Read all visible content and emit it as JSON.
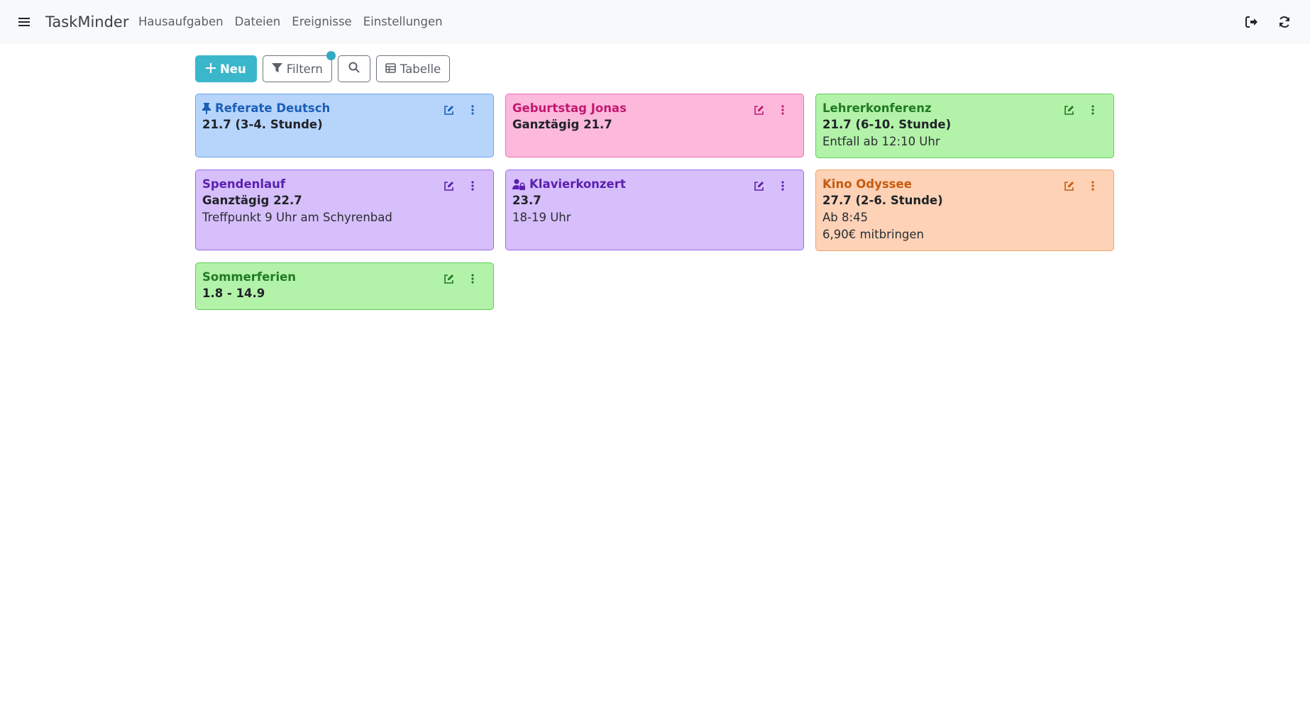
{
  "app": {
    "brand": "TaskMinder"
  },
  "nav": {
    "links": [
      "Hausaufgaben",
      "Dateien",
      "Ereignisse",
      "Einstellungen"
    ]
  },
  "toolbar": {
    "new_label": "Neu",
    "filter_label": "Filtern",
    "table_label": "Tabelle"
  },
  "colors": {
    "primary": "#3bb7cb",
    "blue": "#b7d4fb",
    "pink": "#fcb9dc",
    "green": "#b3f2a9",
    "purple": "#d6bffa",
    "orange": "#fdd2b6"
  },
  "cards": [
    {
      "title": "Referate Deutsch",
      "color": "blue",
      "icon": "pin-icon",
      "lines": [
        "21.7 (3-4. Stunde)"
      ]
    },
    {
      "title": "Geburtstag Jonas",
      "color": "pink",
      "icon": "",
      "lines": [
        "Ganztägig 21.7"
      ]
    },
    {
      "title": "Lehrerkonferenz",
      "color": "green",
      "icon": "",
      "lines": [
        "21.7 (6-10. Stunde)",
        "Entfall ab 12:10 Uhr"
      ]
    },
    {
      "title": "Spendenlauf",
      "color": "purple",
      "icon": "",
      "lines": [
        "Ganztägig 22.7",
        "Treffpunkt 9 Uhr am Schyrenbad"
      ]
    },
    {
      "title": "Klavierkonzert",
      "color": "purple",
      "icon": "user-lock-icon",
      "lines": [
        "23.7",
        "18-19 Uhr"
      ]
    },
    {
      "title": "Kino Odyssee",
      "color": "orange",
      "icon": "",
      "lines": [
        "27.7 (2-6. Stunde)",
        "Ab 8:45",
        "6,90€ mitbringen"
      ]
    },
    {
      "title": "Sommerferien",
      "color": "green",
      "icon": "",
      "lines": [
        "1.8 - 14.9"
      ]
    }
  ]
}
